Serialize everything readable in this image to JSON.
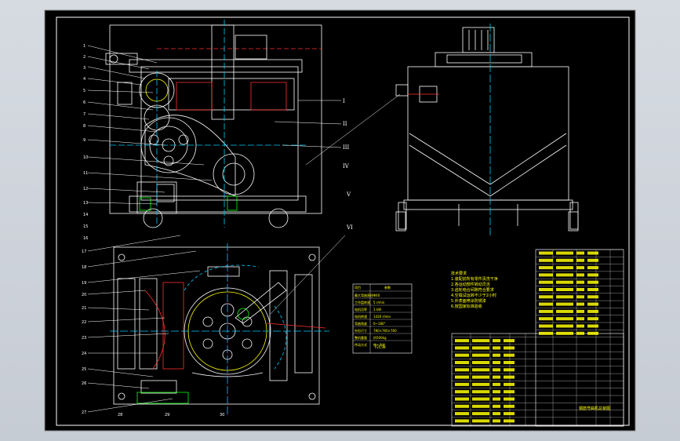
{
  "colors": {
    "background": "#000000",
    "border": "#ffffff",
    "outline": "#ffffff",
    "centerline": "#00c8ff",
    "section": "#ff3030",
    "dimension": "#00ff00",
    "text": "#ffff00",
    "table_line": "#ffffff",
    "viewport_bg": "#d0d6de"
  },
  "views": {
    "front_view": {
      "part_numbers": [
        "1",
        "2",
        "3",
        "4",
        "5",
        "6",
        "7",
        "8",
        "9",
        "10",
        "11",
        "12",
        "13",
        "14",
        "15",
        "16"
      ],
      "section_marks": [
        "I",
        "II",
        "III",
        "IV",
        "V",
        "VI"
      ]
    },
    "top_view": {
      "part_numbers": [
        "17",
        "18",
        "19",
        "20",
        "21",
        "22",
        "23",
        "24",
        "25",
        "26",
        "27",
        "28",
        "29",
        "30"
      ]
    }
  },
  "notes_block": {
    "lines": [
      "技术要求",
      "1.装配前所有零件清洗干净",
      "2.各运动部件转动灵活",
      "3.齿轮啮合间隙符合要求",
      "4.空载试运转不少于2小时",
      "5.外表面喷涂防锈漆",
      "6.按国家标准验收"
    ]
  },
  "spec_table": {
    "header": [
      "项目",
      "参数"
    ],
    "rows": [
      [
        "最大弯曲直径",
        "Φ40"
      ],
      [
        "工作盘转速",
        "5 r/min"
      ],
      [
        "电机功率",
        "3 kW"
      ],
      [
        "电机转速",
        "1420 r/min"
      ],
      [
        "弯曲角度",
        "0~180°"
      ],
      [
        "外形尺寸",
        "780×760×760"
      ],
      [
        "整机重量",
        "约500kg"
      ],
      [
        "传动方式",
        "带+齿轮"
      ]
    ],
    "footer": "Fv1,38"
  },
  "bom_table": {
    "rows": 24,
    "title": "钢筋弯曲机总装图"
  }
}
